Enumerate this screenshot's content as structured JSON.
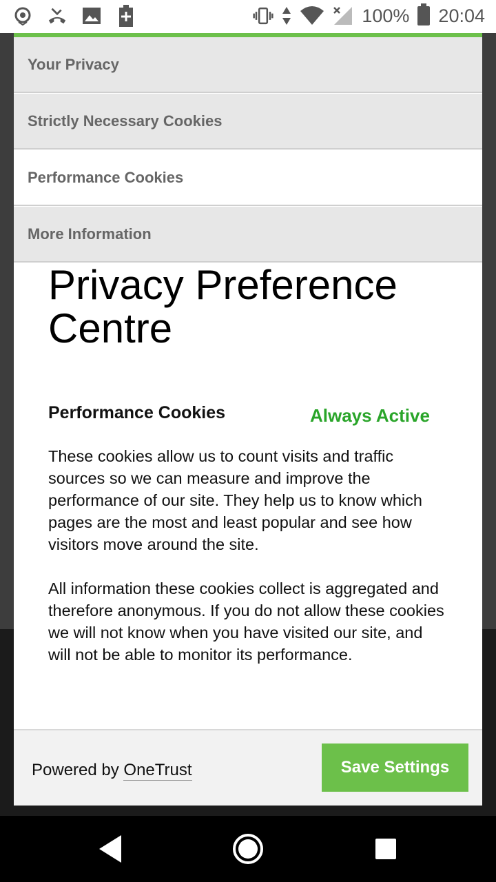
{
  "status_bar": {
    "battery_percent": "100%",
    "time": "20:04",
    "icons": [
      "rose-icon",
      "missed-call-icon",
      "image-icon",
      "battery-saver-icon",
      "vibrate-icon",
      "data-arrows-icon",
      "wifi-icon",
      "signal-icon",
      "battery-icon"
    ]
  },
  "tabs": [
    {
      "label": "Your Privacy",
      "active": false
    },
    {
      "label": "Strictly Necessary Cookies",
      "active": false
    },
    {
      "label": "Performance Cookies",
      "active": true
    },
    {
      "label": "More Information",
      "active": false
    }
  ],
  "modal": {
    "title": "Privacy Preference Centre",
    "section_title": "Performance Cookies",
    "status_label": "Always Active",
    "paragraph_1": "These cookies allow us to count visits and traffic sources so we can measure and improve the performance of our site. They help us to know which pages are the most and least popular and see how visitors move around the site.",
    "paragraph_2": "All information these cookies collect is aggregated and therefore anonymous. If you do not allow these cookies we will not know when you have visited our site, and will not be able to monitor its performance."
  },
  "footer": {
    "powered_prefix": "Powered by ",
    "powered_brand": "OneTrust",
    "save_label": "Save Settings"
  },
  "colors": {
    "accent_green": "#6cc04a",
    "active_green": "#2aa52a"
  },
  "nav_bar": {
    "icons": [
      "back-icon",
      "home-icon",
      "recents-icon"
    ]
  }
}
